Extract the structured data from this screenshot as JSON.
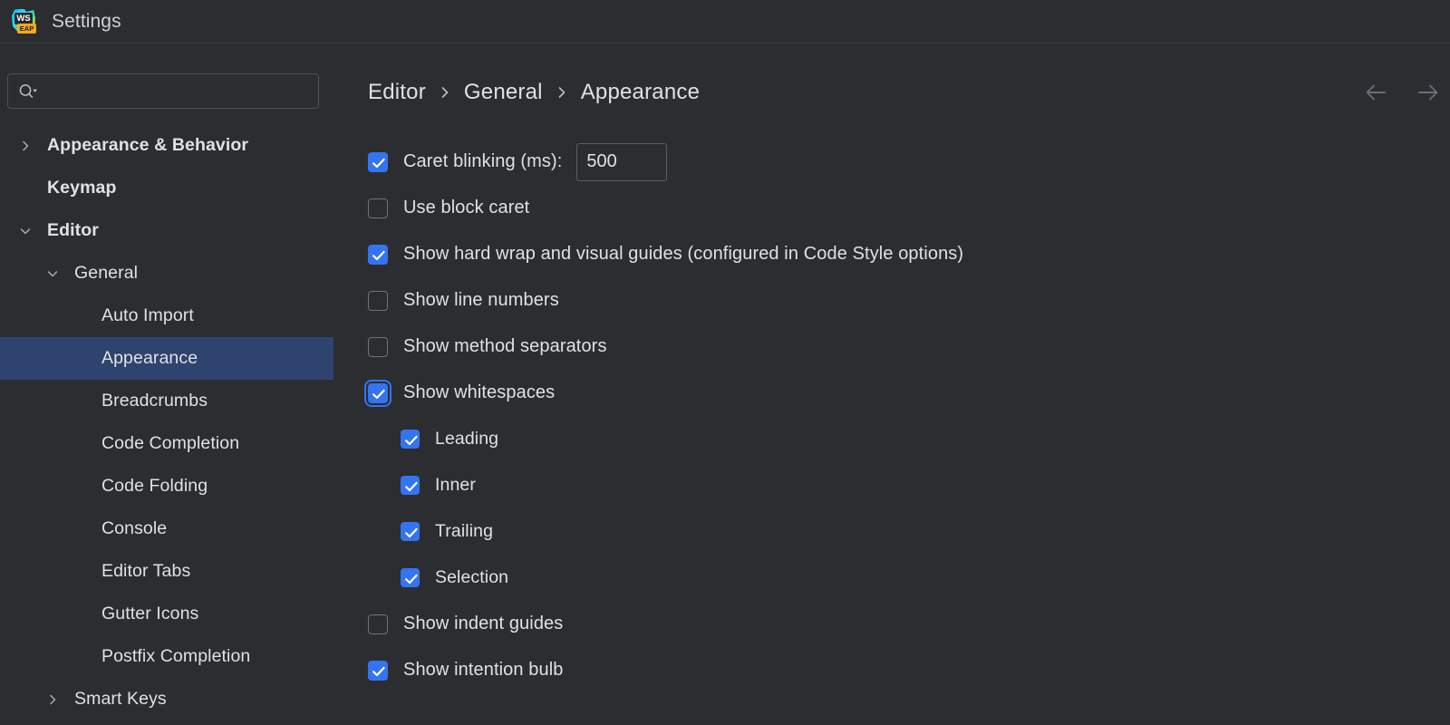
{
  "window": {
    "title": "Settings",
    "app_icon": "webstorm-eap-icon",
    "icon_text": "WS",
    "icon_badge": "EAP"
  },
  "search": {
    "value": "",
    "placeholder": "",
    "icon": "search-icon"
  },
  "sidebar": {
    "items": [
      {
        "label": "Appearance & Behavior",
        "level": 0,
        "chevron": "collapsed",
        "selected": false
      },
      {
        "label": "Keymap",
        "level": 0,
        "chevron": "none",
        "selected": false
      },
      {
        "label": "Editor",
        "level": 0,
        "chevron": "expanded",
        "selected": false
      },
      {
        "label": "General",
        "level": 1,
        "chevron": "expanded",
        "selected": false
      },
      {
        "label": "Auto Import",
        "level": 2,
        "chevron": "none",
        "selected": false
      },
      {
        "label": "Appearance",
        "level": 2,
        "chevron": "none",
        "selected": true
      },
      {
        "label": "Breadcrumbs",
        "level": 2,
        "chevron": "none",
        "selected": false
      },
      {
        "label": "Code Completion",
        "level": 2,
        "chevron": "none",
        "selected": false
      },
      {
        "label": "Code Folding",
        "level": 2,
        "chevron": "none",
        "selected": false
      },
      {
        "label": "Console",
        "level": 2,
        "chevron": "none",
        "selected": false
      },
      {
        "label": "Editor Tabs",
        "level": 2,
        "chevron": "none",
        "selected": false
      },
      {
        "label": "Gutter Icons",
        "level": 2,
        "chevron": "none",
        "selected": false
      },
      {
        "label": "Postfix Completion",
        "level": 2,
        "chevron": "none",
        "selected": false
      },
      {
        "label": "Smart Keys",
        "level": 1,
        "chevron": "collapsed",
        "selected": false
      }
    ]
  },
  "breadcrumb": {
    "separator": "chevron-right-icon",
    "crumbs": [
      "Editor",
      "General",
      "Appearance"
    ]
  },
  "nav": {
    "back": "back-arrow-icon",
    "forward": "forward-arrow-icon"
  },
  "settings": {
    "rows": [
      {
        "label": "Caret blinking (ms):",
        "checked": true,
        "focused": false,
        "indented": false,
        "field": "500"
      },
      {
        "label": "Use block caret",
        "checked": false,
        "focused": false,
        "indented": false,
        "field": null
      },
      {
        "label": "Show hard wrap and visual guides (configured in Code Style options)",
        "checked": true,
        "focused": false,
        "indented": false,
        "field": null
      },
      {
        "label": "Show line numbers",
        "checked": false,
        "focused": false,
        "indented": false,
        "field": null
      },
      {
        "label": "Show method separators",
        "checked": false,
        "focused": false,
        "indented": false,
        "field": null
      },
      {
        "label": "Show whitespaces",
        "checked": true,
        "focused": true,
        "indented": false,
        "field": null
      },
      {
        "label": "Leading",
        "checked": true,
        "focused": false,
        "indented": true,
        "field": null
      },
      {
        "label": "Inner",
        "checked": true,
        "focused": false,
        "indented": true,
        "field": null
      },
      {
        "label": "Trailing",
        "checked": true,
        "focused": false,
        "indented": true,
        "field": null
      },
      {
        "label": "Selection",
        "checked": true,
        "focused": false,
        "indented": true,
        "field": null
      },
      {
        "label": "Show indent guides",
        "checked": false,
        "focused": false,
        "indented": false,
        "field": null
      },
      {
        "label": "Show intention bulb",
        "checked": true,
        "focused": false,
        "indented": false,
        "field": null
      }
    ]
  },
  "colors": {
    "background": "#2b2d30",
    "selection": "#2e436e",
    "accent": "#3574f0",
    "text": "#dfe1e5",
    "border": "#4e5157",
    "badge": "#f7a91c"
  }
}
